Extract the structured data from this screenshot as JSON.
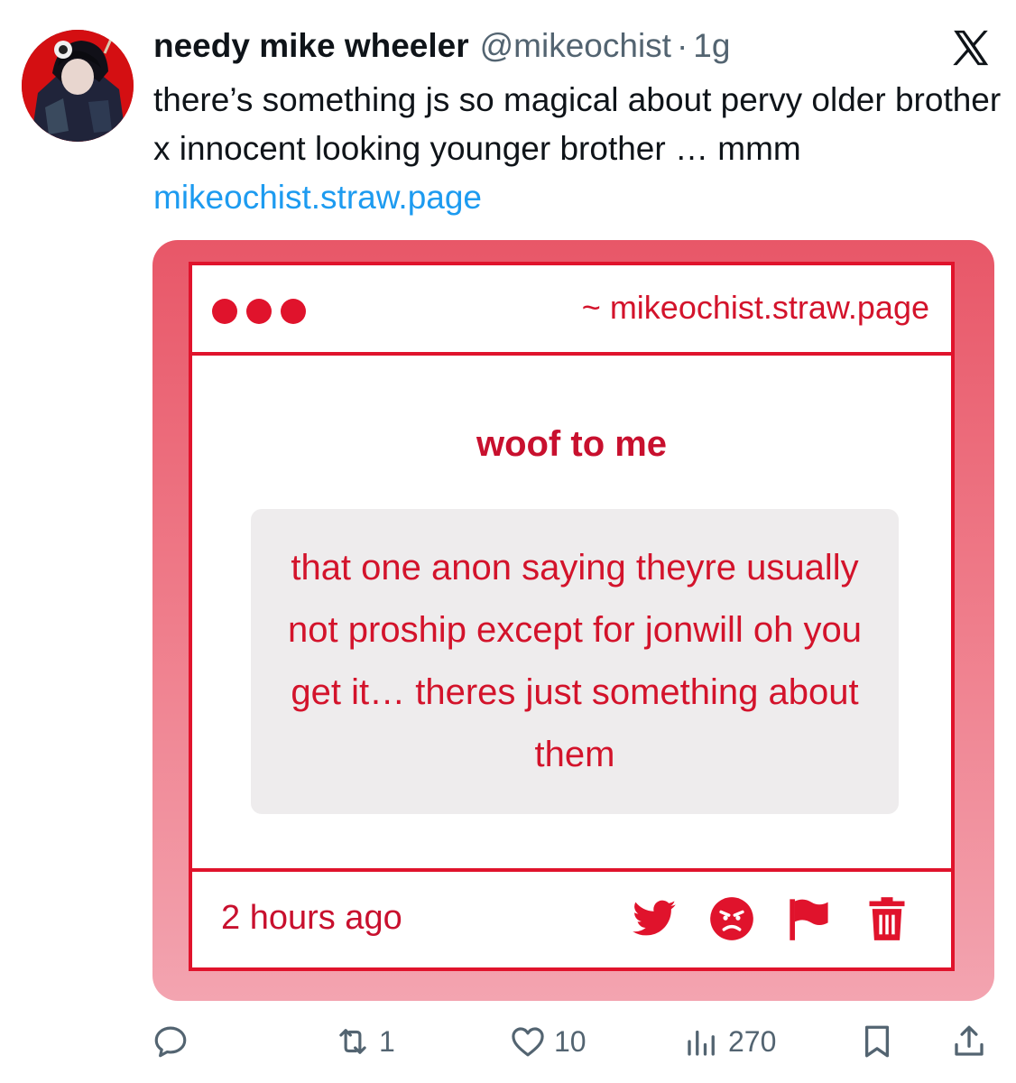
{
  "tweet": {
    "display_name": "needy mike wheeler",
    "handle": "@mikeochist",
    "separator": "·",
    "time": "1g",
    "text_main": "there’s something js so magical about pervy older brother x innocent looking younger brother … mmm ",
    "text_link": "mikeochist.straw.page"
  },
  "embed": {
    "site_url": "~ mikeochist.straw.page",
    "title": "woof to me",
    "message": "that one anon saying theyre usually not proship except for jonwill oh you get it… theres just something about them",
    "time_ago": "2 hours ago",
    "footer_icons": [
      "twitter-bird-icon",
      "angry-face-icon",
      "flag-icon",
      "trash-icon"
    ]
  },
  "actions": {
    "reply_count": "",
    "repost_count": "1",
    "like_count": "10",
    "views_count": "270"
  },
  "colors": {
    "accent_red": "#e0132c",
    "link_blue": "#1d9bf0",
    "muted_gray": "#536471"
  }
}
